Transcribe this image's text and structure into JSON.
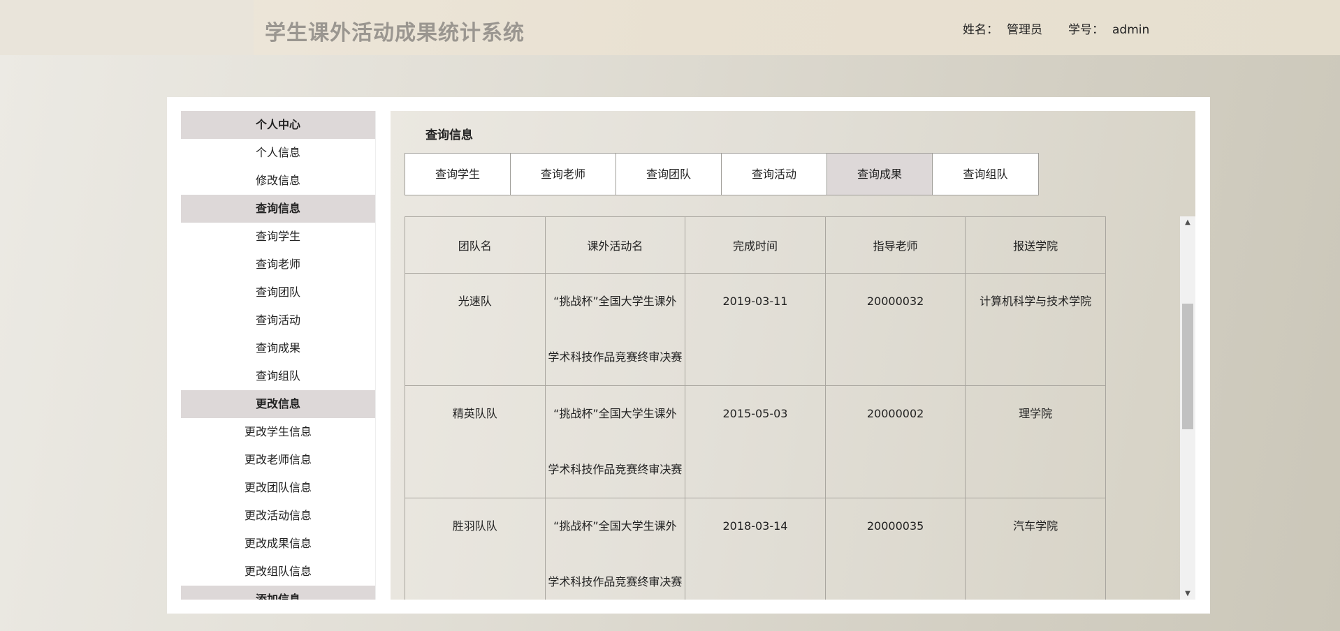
{
  "header": {
    "app_title": "学生课外活动成果统计系统",
    "name_label": "姓名：",
    "name_value": "管理员",
    "id_label": "学号：",
    "id_value": "admin"
  },
  "sidebar": {
    "items": [
      {
        "label": "个人中心",
        "type": "heading"
      },
      {
        "label": "个人信息",
        "type": "link"
      },
      {
        "label": "修改信息",
        "type": "link"
      },
      {
        "label": "查询信息",
        "type": "heading"
      },
      {
        "label": "查询学生",
        "type": "link"
      },
      {
        "label": "查询老师",
        "type": "link"
      },
      {
        "label": "查询团队",
        "type": "link"
      },
      {
        "label": "查询活动",
        "type": "link"
      },
      {
        "label": "查询成果",
        "type": "link"
      },
      {
        "label": "查询组队",
        "type": "link"
      },
      {
        "label": "更改信息",
        "type": "heading"
      },
      {
        "label": "更改学生信息",
        "type": "link"
      },
      {
        "label": "更改老师信息",
        "type": "link"
      },
      {
        "label": "更改团队信息",
        "type": "link"
      },
      {
        "label": "更改活动信息",
        "type": "link"
      },
      {
        "label": "更改成果信息",
        "type": "link"
      },
      {
        "label": "更改组队信息",
        "type": "link"
      },
      {
        "label": "添加信息",
        "type": "heading"
      }
    ]
  },
  "content": {
    "title": "查询信息",
    "tabs": [
      {
        "label": "查询学生",
        "active": false
      },
      {
        "label": "查询老师",
        "active": false
      },
      {
        "label": "查询团队",
        "active": false
      },
      {
        "label": "查询活动",
        "active": false
      },
      {
        "label": "查询成果",
        "active": true
      },
      {
        "label": "查询组队",
        "active": false
      }
    ],
    "table": {
      "headers": [
        "团队名",
        "课外活动名",
        "完成时间",
        "指导老师",
        "报送学院"
      ],
      "rows": [
        {
          "team": "光速队",
          "activity_line1": "“挑战杯”全国大学生课外",
          "activity_line2": "学术科技作品竞赛终审决赛",
          "date": "2019-03-11",
          "teacher": "20000032",
          "college": "计算机科学与技术学院"
        },
        {
          "team": "精英队队",
          "activity_line1": "“挑战杯”全国大学生课外",
          "activity_line2": "学术科技作品竞赛终审决赛",
          "date": "2015-05-03",
          "teacher": "20000002",
          "college": "理学院"
        },
        {
          "team": "胜羽队队",
          "activity_line1": "“挑战杯”全国大学生课外",
          "activity_line2": "学术科技作品竞赛终审决赛",
          "date": "2018-03-14",
          "teacher": "20000035",
          "college": "汽车学院"
        }
      ]
    }
  },
  "scrollbar": {
    "up_arrow": "▲",
    "down_arrow": "▼",
    "position": 0.22
  }
}
